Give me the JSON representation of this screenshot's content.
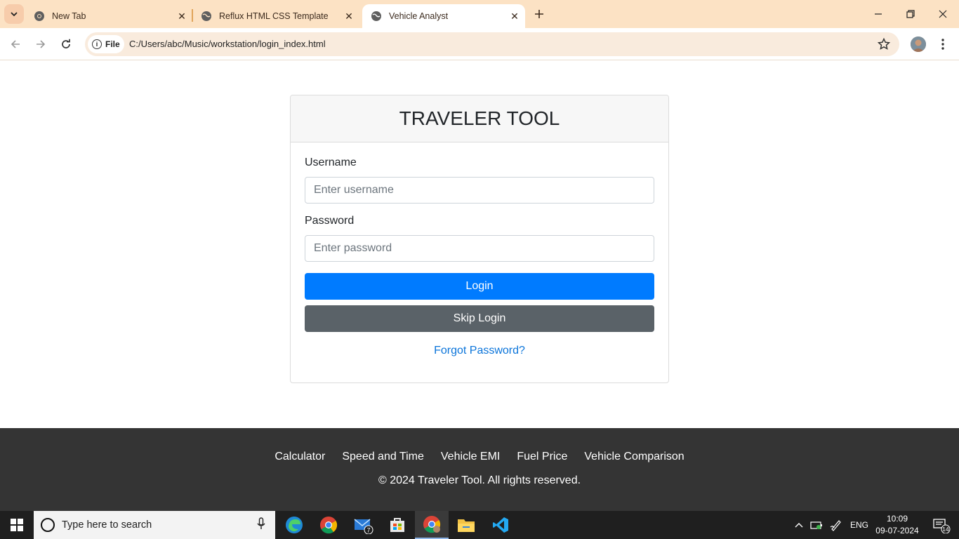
{
  "browser": {
    "tabs": [
      {
        "title": "New Tab",
        "favicon": "chrome-icon",
        "active": false
      },
      {
        "title": "Reflux HTML CSS Template",
        "favicon": "globe-icon",
        "active": false
      },
      {
        "title": "Vehicle Analyst",
        "favicon": "globe-icon",
        "active": true
      }
    ],
    "address_chip": "File",
    "url": "C:/Users/abc/Music/workstation/login_index.html"
  },
  "login": {
    "title": "TRAVELER TOOL",
    "username_label": "Username",
    "username_placeholder": "Enter username",
    "username_value": "",
    "password_label": "Password",
    "password_placeholder": "Enter password",
    "password_value": "",
    "login_button": "Login",
    "skip_button": "Skip Login",
    "forgot_link": "Forgot Password?"
  },
  "footer": {
    "links": [
      "Calculator",
      "Speed and Time",
      "Vehicle EMI",
      "Fuel Price",
      "Vehicle Comparison"
    ],
    "copyright": "© 2024 Traveler Tool. All rights reserved."
  },
  "taskbar": {
    "search_placeholder": "Type here to search",
    "mail_badge": "7",
    "language": "ENG",
    "time": "10:09",
    "date": "09-07-2024",
    "notification_count": "14"
  },
  "colors": {
    "primary": "#007bff",
    "secondary": "#5a6268",
    "footer_bg": "#343434",
    "link": "#0a74da",
    "tabbar_bg": "#fce2c4"
  }
}
